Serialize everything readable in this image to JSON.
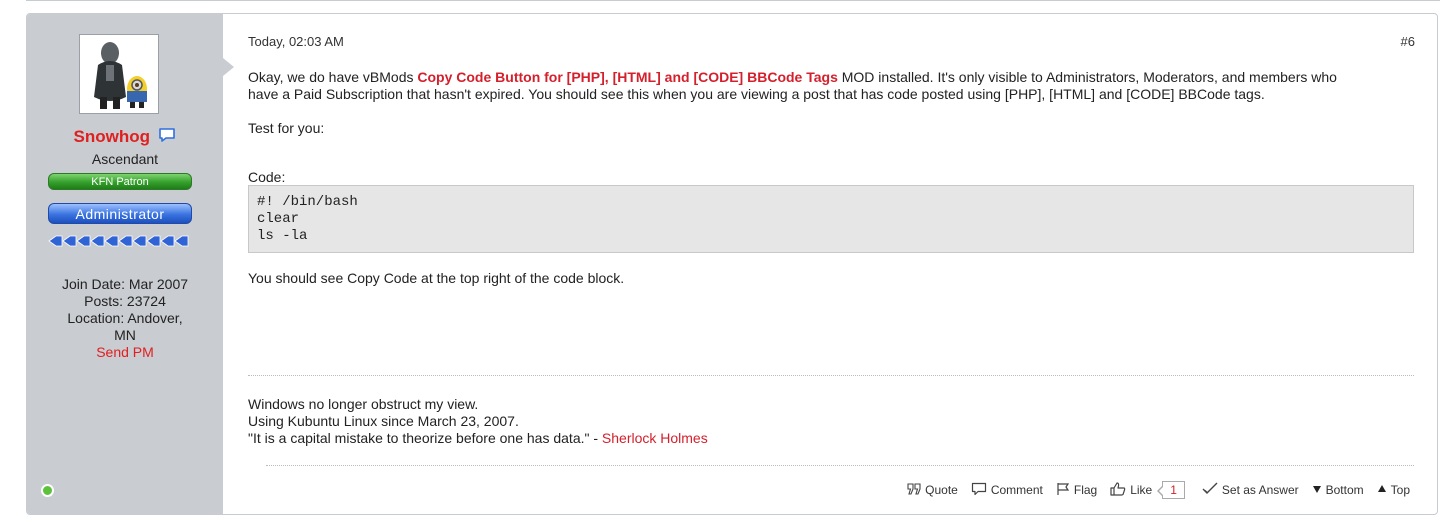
{
  "post": {
    "number": "#6",
    "date": "Today, 02:03 AM",
    "author": {
      "username": "Snowhog",
      "title": "Ascendant",
      "badges": [
        "KFN Patron",
        "Administrator"
      ],
      "join_date": "Join Date: Mar 2007",
      "posts": "Posts: 23724",
      "location_line1": "Location: Andover,",
      "location_line2": "MN",
      "send_pm": "Send PM",
      "online": true
    },
    "body": {
      "p1_a": "Okay, we do have vBMods ",
      "p1_link": "Copy Code Button for [PHP], [HTML] and [CODE] BBCode Tags",
      "p1_b": " MOD installed. It's only visible to Administrators, Moderators, and members who",
      "p1_c": "have a Paid Subscription that hasn't expired. You should see this when you are viewing a post that has code posted using [PHP], [HTML] and [CODE] BBCode tags.",
      "p2": "Test for you:",
      "code_label": "Code:",
      "code_lines": [
        "#! /bin/bash",
        "clear",
        "ls -la"
      ],
      "p3": "You should see Copy Code at the top right of the code block."
    },
    "signature": {
      "line1": "Windows no longer obstruct my view.",
      "line2": "Using Kubuntu Linux since March 23, 2007.",
      "line3_text": "\"It is a capital mistake to theorize before one has data.\" - ",
      "line3_link": "Sherlock Holmes"
    },
    "actions": {
      "quote": "Quote",
      "comment": "Comment",
      "flag": "Flag",
      "like": "Like",
      "like_count": "1",
      "set_answer": "Set as Answer",
      "bottom": "Bottom",
      "top": "Top"
    }
  },
  "colors": {
    "accent_red": "#d4202c",
    "sidebar_bg": "#c9ccd0",
    "online_green": "#5cc23c"
  }
}
